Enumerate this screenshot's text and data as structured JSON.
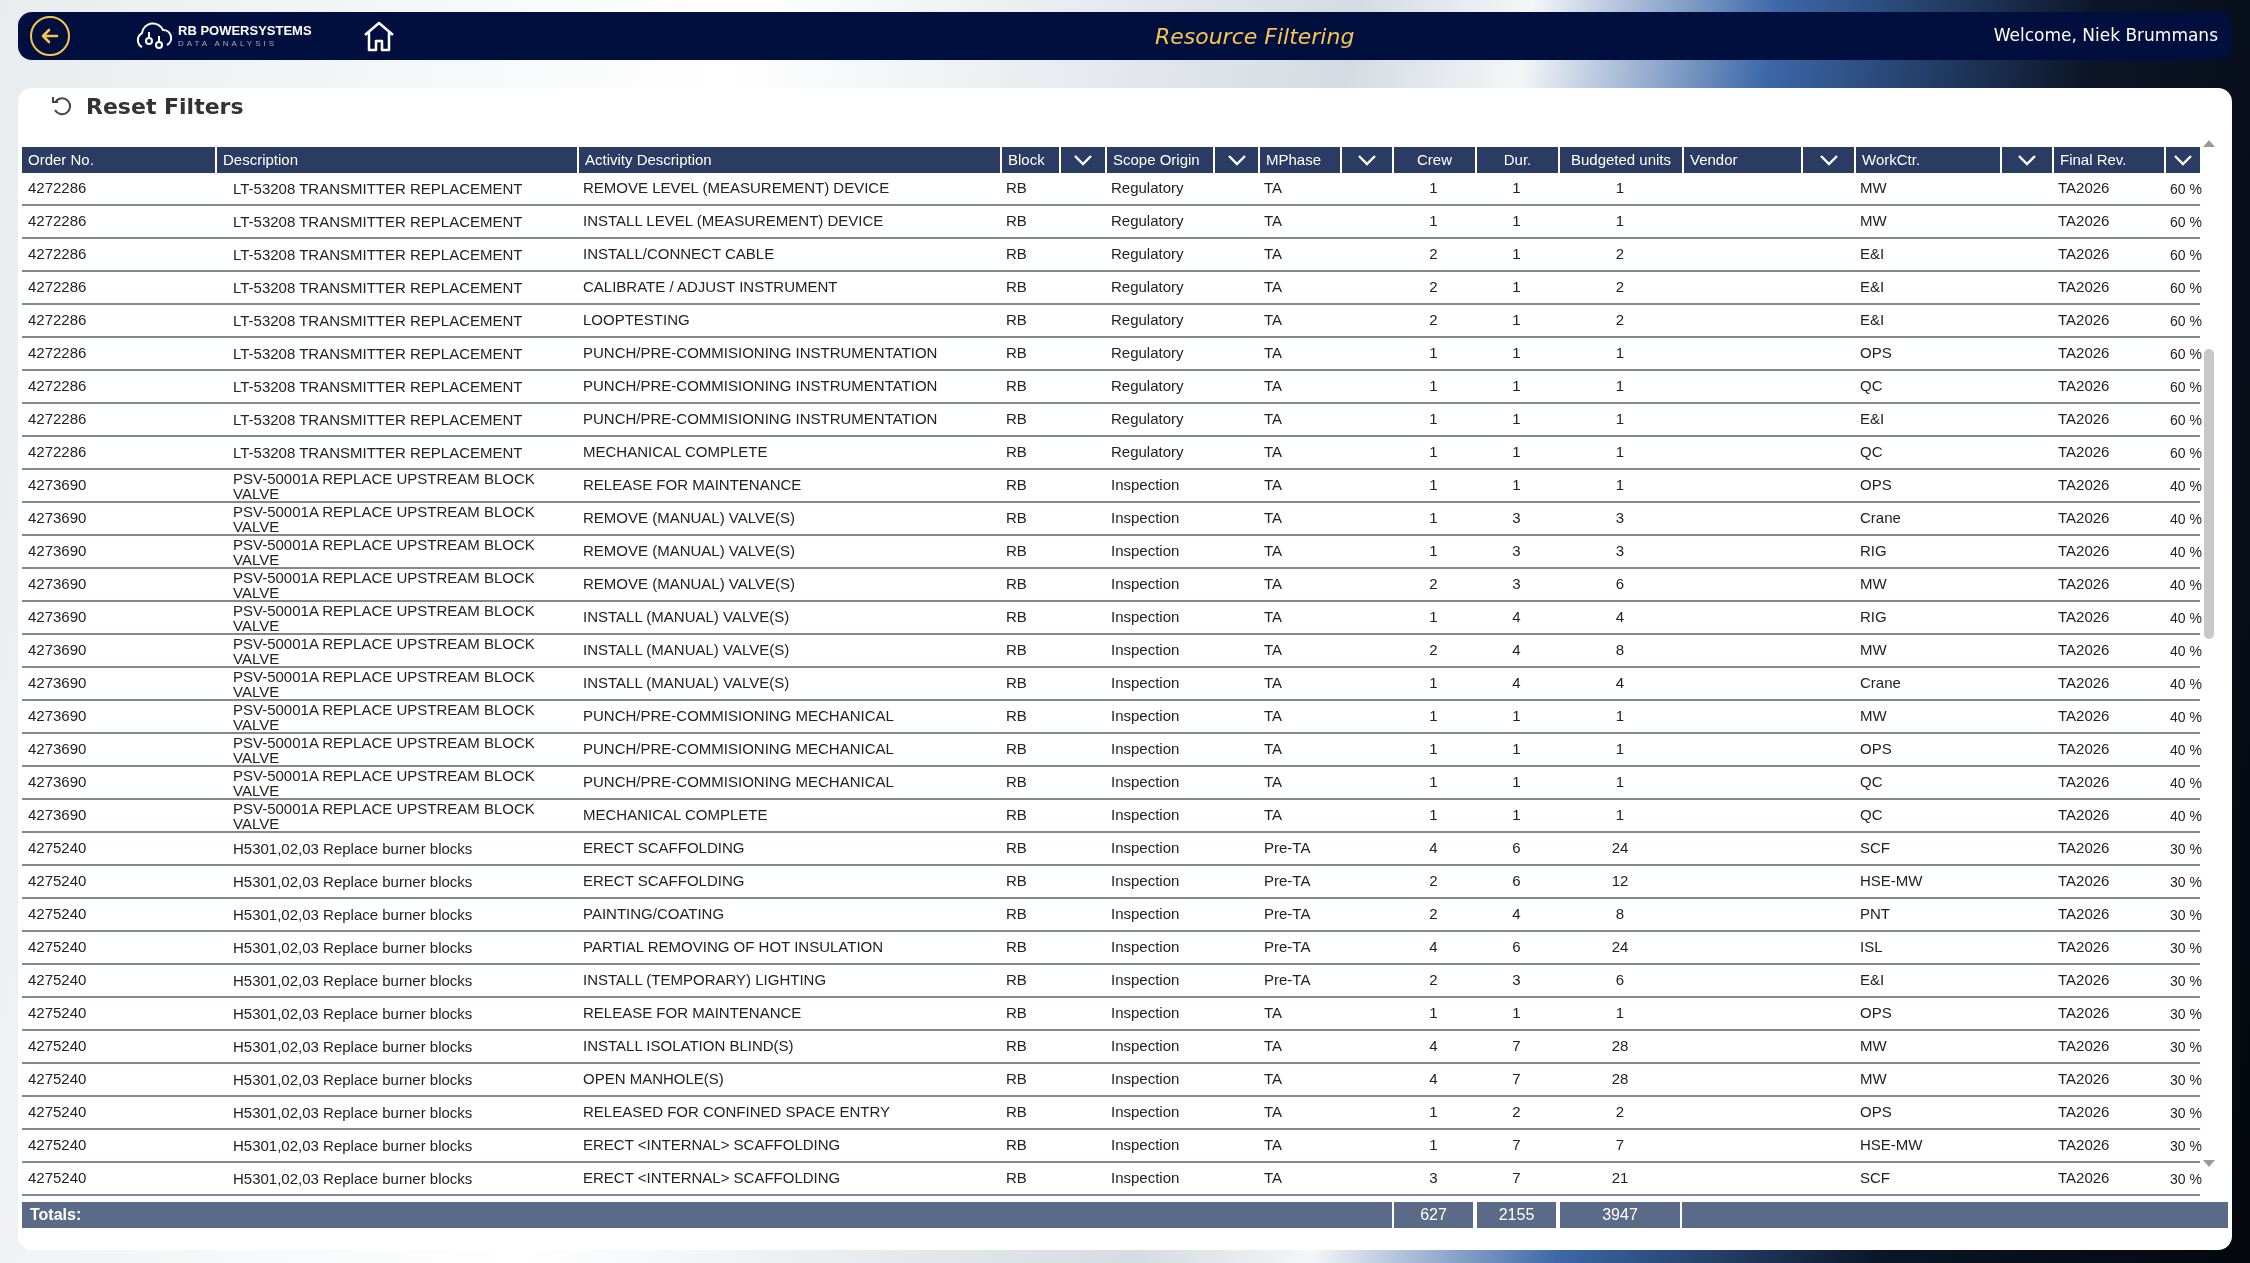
{
  "top_bar": {
    "brand": "RB POWERSYSTEMS",
    "brand_subtitle": "DATA ANALYSIS",
    "title": "Resource Filtering",
    "welcome": "Welcome, Niek Brummans"
  },
  "toolbar": {
    "reset_label": "Reset Filters"
  },
  "table": {
    "columns": [
      {
        "label": "Order No.",
        "filter": false
      },
      {
        "label": "Description",
        "filter": false
      },
      {
        "label": "Activity Description",
        "filter": false
      },
      {
        "label": "Block",
        "filter": true
      },
      {
        "label": "Scope Origin",
        "filter": true
      },
      {
        "label": "MPhase",
        "filter": true
      },
      {
        "label": "Crew",
        "filter": false
      },
      {
        "label": "Dur.",
        "filter": false
      },
      {
        "label": "Budgeted units",
        "filter": false
      },
      {
        "label": "Vendor",
        "filter": true
      },
      {
        "label": "WorkCtr.",
        "filter": true
      },
      {
        "label": "Final Rev.",
        "filter": true
      }
    ],
    "rows": [
      {
        "order_no": "4272286",
        "description": "LT-53208 TRANSMITTER REPLACEMENT",
        "activity": "REMOVE LEVEL (MEASUREMENT) DEVICE",
        "block": "RB",
        "scope_origin": "Regulatory",
        "mphase": "TA",
        "crew": "1",
        "dur": "1",
        "budgeted_units": "1",
        "workctr": "MW",
        "final_rev": "TA2026",
        "column_13": "60 %"
      },
      {
        "order_no": "4272286",
        "description": "LT-53208 TRANSMITTER REPLACEMENT",
        "activity": "INSTALL LEVEL (MEASUREMENT) DEVICE",
        "block": "RB",
        "scope_origin": "Regulatory",
        "mphase": "TA",
        "crew": "1",
        "dur": "1",
        "budgeted_units": "1",
        "workctr": "MW",
        "final_rev": "TA2026",
        "column_13": "60 %"
      },
      {
        "order_no": "4272286",
        "description": "LT-53208 TRANSMITTER REPLACEMENT",
        "activity": "INSTALL/CONNECT CABLE",
        "block": "RB",
        "scope_origin": "Regulatory",
        "mphase": "TA",
        "crew": "2",
        "dur": "1",
        "budgeted_units": "2",
        "workctr": "E&I",
        "final_rev": "TA2026",
        "column_13": "60 %"
      },
      {
        "order_no": "4272286",
        "description": "LT-53208 TRANSMITTER REPLACEMENT",
        "activity": "CALIBRATE / ADJUST INSTRUMENT",
        "block": "RB",
        "scope_origin": "Regulatory",
        "mphase": "TA",
        "crew": "2",
        "dur": "1",
        "budgeted_units": "2",
        "workctr": "E&I",
        "final_rev": "TA2026",
        "column_13": "60 %"
      },
      {
        "order_no": "4272286",
        "description": "LT-53208 TRANSMITTER REPLACEMENT",
        "activity": "LOOPTESTING",
        "block": "RB",
        "scope_origin": "Regulatory",
        "mphase": "TA",
        "crew": "2",
        "dur": "1",
        "budgeted_units": "2",
        "workctr": "E&I",
        "final_rev": "TA2026",
        "column_13": "60 %"
      },
      {
        "order_no": "4272286",
        "description": "LT-53208 TRANSMITTER REPLACEMENT",
        "activity": "PUNCH/PRE-COMMISIONING  INSTRUMENTATION",
        "block": "RB",
        "scope_origin": "Regulatory",
        "mphase": "TA",
        "crew": "1",
        "dur": "1",
        "budgeted_units": "1",
        "workctr": "OPS",
        "final_rev": "TA2026",
        "column_13": "60 %"
      },
      {
        "order_no": "4272286",
        "description": "LT-53208 TRANSMITTER REPLACEMENT",
        "activity": "PUNCH/PRE-COMMISIONING  INSTRUMENTATION",
        "block": "RB",
        "scope_origin": "Regulatory",
        "mphase": "TA",
        "crew": "1",
        "dur": "1",
        "budgeted_units": "1",
        "workctr": "QC",
        "final_rev": "TA2026",
        "column_13": "60 %"
      },
      {
        "order_no": "4272286",
        "description": "LT-53208 TRANSMITTER REPLACEMENT",
        "activity": "PUNCH/PRE-COMMISIONING  INSTRUMENTATION",
        "block": "RB",
        "scope_origin": "Regulatory",
        "mphase": "TA",
        "crew": "1",
        "dur": "1",
        "budgeted_units": "1",
        "workctr": "E&I",
        "final_rev": "TA2026",
        "column_13": "60 %"
      },
      {
        "order_no": "4272286",
        "description": "LT-53208 TRANSMITTER REPLACEMENT",
        "activity": "MECHANICAL COMPLETE",
        "block": "RB",
        "scope_origin": "Regulatory",
        "mphase": "TA",
        "crew": "1",
        "dur": "1",
        "budgeted_units": "1",
        "workctr": "QC",
        "final_rev": "TA2026",
        "column_13": "60 %"
      },
      {
        "order_no": "4273690",
        "description": "PSV-50001A REPLACE UPSTREAM BLOCK VALVE",
        "activity": "RELEASE FOR MAINTENANCE",
        "block": "RB",
        "scope_origin": "Inspection",
        "mphase": "TA",
        "crew": "1",
        "dur": "1",
        "budgeted_units": "1",
        "workctr": "OPS",
        "final_rev": "TA2026",
        "column_13": "40 %"
      },
      {
        "order_no": "4273690",
        "description": "PSV-50001A REPLACE UPSTREAM BLOCK VALVE",
        "activity": "REMOVE (MANUAL) VALVE(S)",
        "block": "RB",
        "scope_origin": "Inspection",
        "mphase": "TA",
        "crew": "1",
        "dur": "3",
        "budgeted_units": "3",
        "workctr": "Crane",
        "final_rev": "TA2026",
        "column_13": "40 %"
      },
      {
        "order_no": "4273690",
        "description": "PSV-50001A REPLACE UPSTREAM BLOCK VALVE",
        "activity": "REMOVE (MANUAL) VALVE(S)",
        "block": "RB",
        "scope_origin": "Inspection",
        "mphase": "TA",
        "crew": "1",
        "dur": "3",
        "budgeted_units": "3",
        "workctr": "RIG",
        "final_rev": "TA2026",
        "column_13": "40 %"
      },
      {
        "order_no": "4273690",
        "description": "PSV-50001A REPLACE UPSTREAM BLOCK VALVE",
        "activity": "REMOVE (MANUAL) VALVE(S)",
        "block": "RB",
        "scope_origin": "Inspection",
        "mphase": "TA",
        "crew": "2",
        "dur": "3",
        "budgeted_units": "6",
        "workctr": "MW",
        "final_rev": "TA2026",
        "column_13": "40 %"
      },
      {
        "order_no": "4273690",
        "description": "PSV-50001A REPLACE UPSTREAM BLOCK VALVE",
        "activity": "INSTALL (MANUAL) VALVE(S)",
        "block": "RB",
        "scope_origin": "Inspection",
        "mphase": "TA",
        "crew": "1",
        "dur": "4",
        "budgeted_units": "4",
        "workctr": "RIG",
        "final_rev": "TA2026",
        "column_13": "40 %"
      },
      {
        "order_no": "4273690",
        "description": "PSV-50001A REPLACE UPSTREAM BLOCK VALVE",
        "activity": "INSTALL (MANUAL) VALVE(S)",
        "block": "RB",
        "scope_origin": "Inspection",
        "mphase": "TA",
        "crew": "2",
        "dur": "4",
        "budgeted_units": "8",
        "workctr": "MW",
        "final_rev": "TA2026",
        "column_13": "40 %"
      },
      {
        "order_no": "4273690",
        "description": "PSV-50001A REPLACE UPSTREAM BLOCK VALVE",
        "activity": "INSTALL (MANUAL) VALVE(S)",
        "block": "RB",
        "scope_origin": "Inspection",
        "mphase": "TA",
        "crew": "1",
        "dur": "4",
        "budgeted_units": "4",
        "workctr": "Crane",
        "final_rev": "TA2026",
        "column_13": "40 %"
      },
      {
        "order_no": "4273690",
        "description": "PSV-50001A REPLACE UPSTREAM BLOCK VALVE",
        "activity": "PUNCH/PRE-COMMISIONING MECHANICAL",
        "block": "RB",
        "scope_origin": "Inspection",
        "mphase": "TA",
        "crew": "1",
        "dur": "1",
        "budgeted_units": "1",
        "workctr": "MW",
        "final_rev": "TA2026",
        "column_13": "40 %"
      },
      {
        "order_no": "4273690",
        "description": "PSV-50001A REPLACE UPSTREAM BLOCK VALVE",
        "activity": "PUNCH/PRE-COMMISIONING MECHANICAL",
        "block": "RB",
        "scope_origin": "Inspection",
        "mphase": "TA",
        "crew": "1",
        "dur": "1",
        "budgeted_units": "1",
        "workctr": "OPS",
        "final_rev": "TA2026",
        "column_13": "40 %"
      },
      {
        "order_no": "4273690",
        "description": "PSV-50001A REPLACE UPSTREAM BLOCK VALVE",
        "activity": "PUNCH/PRE-COMMISIONING MECHANICAL",
        "block": "RB",
        "scope_origin": "Inspection",
        "mphase": "TA",
        "crew": "1",
        "dur": "1",
        "budgeted_units": "1",
        "workctr": "QC",
        "final_rev": "TA2026",
        "column_13": "40 %"
      },
      {
        "order_no": "4273690",
        "description": "PSV-50001A REPLACE UPSTREAM BLOCK VALVE",
        "activity": "MECHANICAL COMPLETE",
        "block": "RB",
        "scope_origin": "Inspection",
        "mphase": "TA",
        "crew": "1",
        "dur": "1",
        "budgeted_units": "1",
        "workctr": "QC",
        "final_rev": "TA2026",
        "column_13": "40 %"
      },
      {
        "order_no": "4275240",
        "description": "H5301,02,03 Replace burner blocks",
        "activity": "ERECT SCAFFOLDING",
        "block": "RB",
        "scope_origin": "Inspection",
        "mphase": "Pre-TA",
        "crew": "4",
        "dur": "6",
        "budgeted_units": "24",
        "workctr": "SCF",
        "final_rev": "TA2026",
        "column_13": "30 %"
      },
      {
        "order_no": "4275240",
        "description": "H5301,02,03 Replace burner blocks",
        "activity": "ERECT SCAFFOLDING",
        "block": "RB",
        "scope_origin": "Inspection",
        "mphase": "Pre-TA",
        "crew": "2",
        "dur": "6",
        "budgeted_units": "12",
        "workctr": "HSE-MW",
        "final_rev": "TA2026",
        "column_13": "30 %"
      },
      {
        "order_no": "4275240",
        "description": "H5301,02,03 Replace burner blocks",
        "activity": "PAINTING/COATING",
        "block": "RB",
        "scope_origin": "Inspection",
        "mphase": "Pre-TA",
        "crew": "2",
        "dur": "4",
        "budgeted_units": "8",
        "workctr": "PNT",
        "final_rev": "TA2026",
        "column_13": "30 %"
      },
      {
        "order_no": "4275240",
        "description": "H5301,02,03 Replace burner blocks",
        "activity": "PARTIAL REMOVING OF HOT INSULATION",
        "block": "RB",
        "scope_origin": "Inspection",
        "mphase": "Pre-TA",
        "crew": "4",
        "dur": "6",
        "budgeted_units": "24",
        "workctr": "ISL",
        "final_rev": "TA2026",
        "column_13": "30 %"
      },
      {
        "order_no": "4275240",
        "description": "H5301,02,03 Replace burner blocks",
        "activity": "INSTALL (TEMPORARY) LIGHTING",
        "block": "RB",
        "scope_origin": "Inspection",
        "mphase": "Pre-TA",
        "crew": "2",
        "dur": "3",
        "budgeted_units": "6",
        "workctr": "E&I",
        "final_rev": "TA2026",
        "column_13": "30 %"
      },
      {
        "order_no": "4275240",
        "description": "H5301,02,03 Replace burner blocks",
        "activity": "RELEASE FOR MAINTENANCE",
        "block": "RB",
        "scope_origin": "Inspection",
        "mphase": "TA",
        "crew": "1",
        "dur": "1",
        "budgeted_units": "1",
        "workctr": "OPS",
        "final_rev": "TA2026",
        "column_13": "30 %"
      },
      {
        "order_no": "4275240",
        "description": "H5301,02,03 Replace burner blocks",
        "activity": "INSTALL ISOLATION BLIND(S)",
        "block": "RB",
        "scope_origin": "Inspection",
        "mphase": "TA",
        "crew": "4",
        "dur": "7",
        "budgeted_units": "28",
        "workctr": "MW",
        "final_rev": "TA2026",
        "column_13": "30 %"
      },
      {
        "order_no": "4275240",
        "description": "H5301,02,03 Replace burner blocks",
        "activity": "OPEN MANHOLE(S)",
        "block": "RB",
        "scope_origin": "Inspection",
        "mphase": "TA",
        "crew": "4",
        "dur": "7",
        "budgeted_units": "28",
        "workctr": "MW",
        "final_rev": "TA2026",
        "column_13": "30 %"
      },
      {
        "order_no": "4275240",
        "description": "H5301,02,03 Replace burner blocks",
        "activity": "RELEASED FOR CONFINED SPACE ENTRY",
        "block": "RB",
        "scope_origin": "Inspection",
        "mphase": "TA",
        "crew": "1",
        "dur": "2",
        "budgeted_units": "2",
        "workctr": "OPS",
        "final_rev": "TA2026",
        "column_13": "30 %"
      },
      {
        "order_no": "4275240",
        "description": "H5301,02,03 Replace burner blocks",
        "activity": "ERECT <INTERNAL> SCAFFOLDING",
        "block": "RB",
        "scope_origin": "Inspection",
        "mphase": "TA",
        "crew": "1",
        "dur": "7",
        "budgeted_units": "7",
        "workctr": "HSE-MW",
        "final_rev": "TA2026",
        "column_13": "30 %"
      },
      {
        "order_no": "4275240",
        "description": "H5301,02,03 Replace burner blocks",
        "activity": "ERECT <INTERNAL> SCAFFOLDING",
        "block": "RB",
        "scope_origin": "Inspection",
        "mphase": "TA",
        "crew": "3",
        "dur": "7",
        "budgeted_units": "21",
        "workctr": "SCF",
        "final_rev": "TA2026",
        "column_13": "30 %"
      }
    ],
    "totals": {
      "label": "Totals:",
      "crew": "627",
      "dur": "2155",
      "budgeted_units": "3947"
    }
  }
}
